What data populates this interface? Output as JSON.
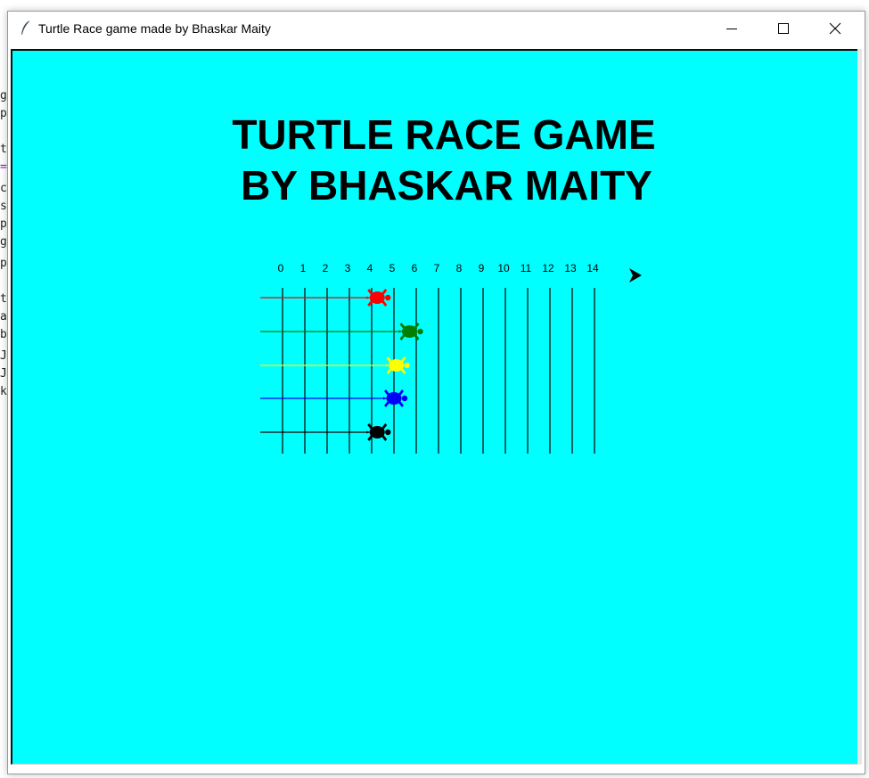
{
  "window": {
    "title": "Turtle Race game made by Bhaskar Maity",
    "icon": "feather-icon",
    "controls": [
      "minimize-icon",
      "maximize-icon",
      "close-icon"
    ]
  },
  "background_editor_chars": [
    "g",
    "p",
    "t",
    "=",
    "c",
    "s",
    "p",
    "g",
    "p",
    "t",
    "a",
    "b",
    "J",
    "J",
    "k"
  ],
  "game": {
    "title_lines": [
      "TURTLE RACE GAME",
      "BY BHASKAR MAITY"
    ],
    "track_labels": [
      "0",
      "1",
      "2",
      "3",
      "4",
      "5",
      "6",
      "7",
      "8",
      "9",
      "10",
      "11",
      "12",
      "13",
      "14"
    ],
    "turtles": [
      {
        "color": "red",
        "hex": "#ff0000",
        "progress": 4.25
      },
      {
        "color": "green",
        "hex": "#008000",
        "progress": 5.7
      },
      {
        "color": "yellow",
        "hex": "#ffff00",
        "progress": 5.1
      },
      {
        "color": "blue",
        "hex": "#0000ff",
        "progress": 5.0
      },
      {
        "color": "black",
        "hex": "#000000",
        "progress": 4.25
      }
    ],
    "canvas_bg": "#00ffff",
    "pointer": "arrow-cursor-icon"
  }
}
